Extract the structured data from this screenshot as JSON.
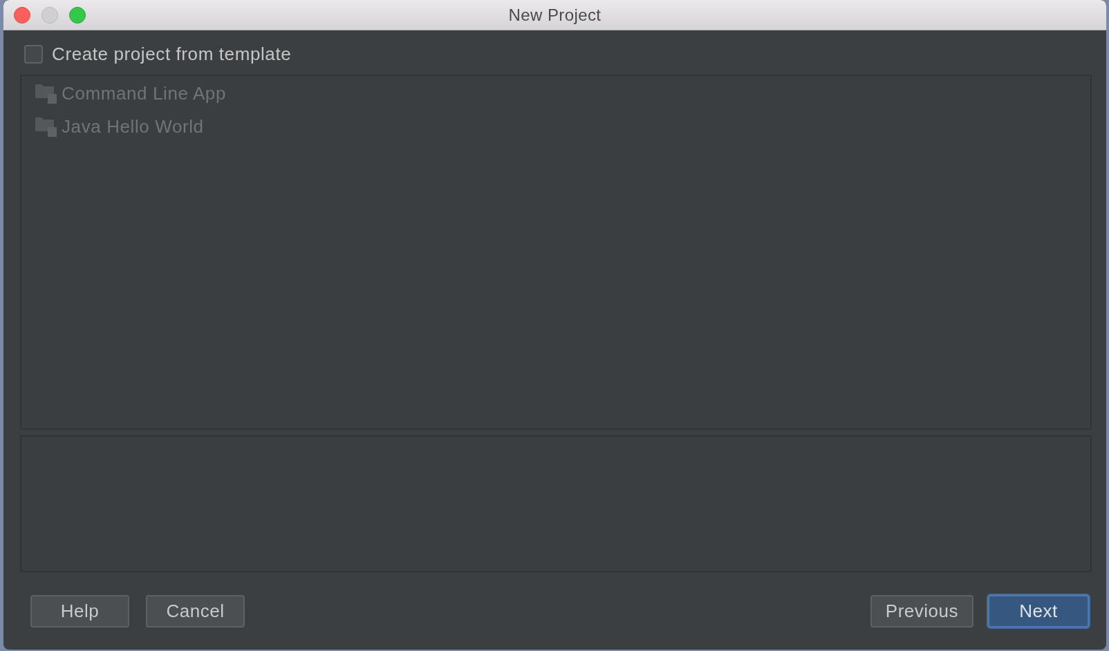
{
  "window": {
    "title": "New Project",
    "controls": [
      {
        "kind": "close",
        "disabled": false
      },
      {
        "kind": "minimize",
        "disabled": true
      },
      {
        "kind": "zoom",
        "disabled": false
      }
    ]
  },
  "template_option": {
    "label": "Create project from template",
    "checked": false
  },
  "templates": {
    "disabled": true,
    "items": [
      {
        "label": "Command Line App",
        "selected": false
      },
      {
        "label": "Java Hello World",
        "selected": false
      }
    ]
  },
  "footer": {
    "left_buttons": [
      {
        "label": "Help",
        "default": false
      },
      {
        "label": "Cancel",
        "default": false
      }
    ],
    "right_buttons": [
      {
        "label": "Previous",
        "default": false
      },
      {
        "label": "Next",
        "default": true
      }
    ]
  }
}
